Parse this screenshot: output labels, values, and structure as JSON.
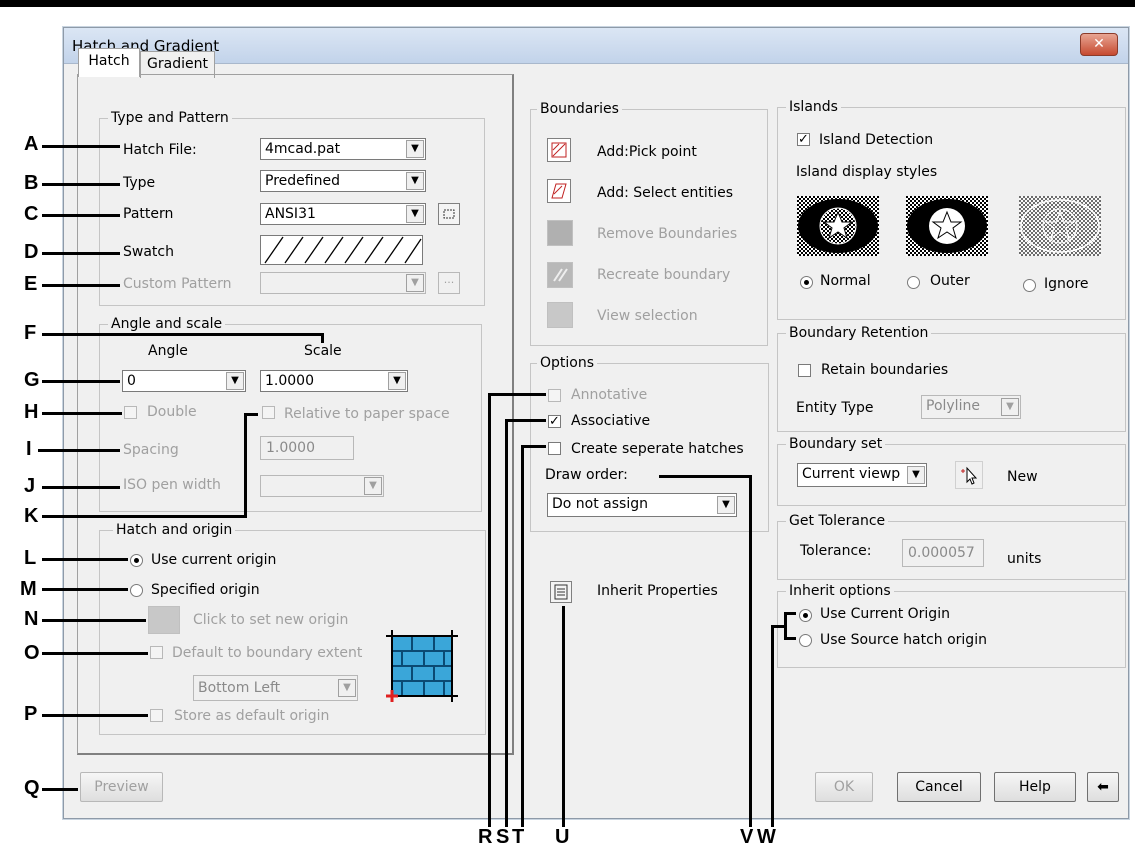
{
  "window": {
    "title": "Hatch and Gradient",
    "close_label": "✕"
  },
  "tabs": [
    {
      "label": "Hatch"
    },
    {
      "label": "Gradient"
    }
  ],
  "type_pattern": {
    "group_title": "Type and Pattern",
    "hatch_file_label": "Hatch File:",
    "hatch_file_value": "4mcad.pat",
    "type_label": "Type",
    "type_value": "Predefined",
    "pattern_label": "Pattern",
    "pattern_value": "ANSI31",
    "swatch_label": "Swatch",
    "custom_pattern_label": "Custom Pattern"
  },
  "angle_scale": {
    "group_title": "Angle and scale",
    "angle_label": "Angle",
    "scale_label": "Scale",
    "angle_value": "0",
    "scale_value": "1.0000",
    "double_label": "Double",
    "relative_label": "Relative to paper space",
    "spacing_label": "Spacing",
    "spacing_value": "1.0000",
    "iso_label": "ISO pen width"
  },
  "hatch_origin": {
    "group_title": "Hatch and origin",
    "use_current_label": "Use current origin",
    "specified_label": "Specified origin",
    "click_set_label": "Click to set new origin",
    "default_extent_label": "Default to boundary extent",
    "position_value": "Bottom Left",
    "store_default_label": "Store as default origin"
  },
  "boundaries": {
    "group_title": "Boundaries",
    "add_pick_label": "Add:Pick point",
    "add_select_label": "Add: Select entities",
    "remove_label": "Remove Boundaries",
    "recreate_label": "Recreate boundary",
    "view_label": "View selection"
  },
  "options": {
    "group_title": "Options",
    "annotative_label": "Annotative",
    "associative_label": "Associative",
    "separate_label": "Create seperate hatches",
    "draw_order_label": "Draw order:",
    "draw_order_value": "Do not assign",
    "inherit_label": "Inherit Properties"
  },
  "islands": {
    "group_title": "Islands",
    "detection_label": "Island Detection",
    "styles_label": "Island display styles",
    "normal_label": "Normal",
    "outer_label": "Outer",
    "ignore_label": "Ignore"
  },
  "retention": {
    "group_title": "Boundary Retention",
    "retain_label": "Retain boundaries",
    "entity_type_label": "Entity Type",
    "entity_type_value": "Polyline"
  },
  "boundary_set": {
    "group_title": "Boundary set",
    "set_value": "Current viewp",
    "new_label": "New"
  },
  "tolerance": {
    "group_title": "Get Tolerance",
    "label": "Tolerance:",
    "value": "0.000057",
    "units": "units"
  },
  "inherit_options": {
    "group_title": "Inherit options",
    "current_origin_label": "Use Current Origin",
    "source_origin_label": "Use Source hatch origin"
  },
  "footer": {
    "preview_label": "Preview",
    "ok_label": "OK",
    "cancel_label": "Cancel",
    "help_label": "Help",
    "arrow_label": "⬅"
  },
  "markers": {
    "A": "A",
    "B": "B",
    "C": "C",
    "D": "D",
    "E": "E",
    "F": "F",
    "G": "G",
    "H": "H",
    "I": "I",
    "J": "J",
    "K": "K",
    "L": "L",
    "M": "M",
    "N": "N",
    "O": "O",
    "P": "P",
    "Q": "Q",
    "R": "R",
    "S": "S",
    "T": "T",
    "U": "U",
    "V": "V",
    "W": "W"
  },
  "colors": {
    "accent": "#1f4f8b",
    "window_bg": "#f0f0f0",
    "close": "#c64a30"
  }
}
